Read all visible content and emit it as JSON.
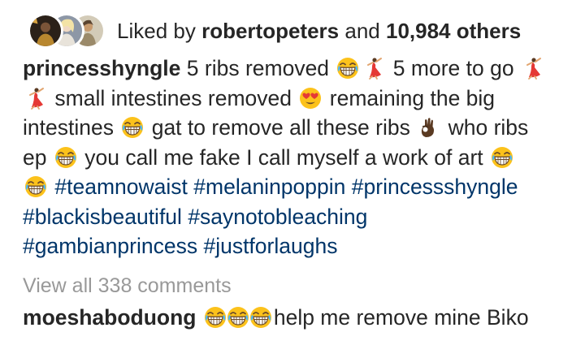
{
  "likes": {
    "prefix": "Liked by",
    "user": "robertopeters",
    "conjunction": "and",
    "count": "10,984 others"
  },
  "post": {
    "username": "princesshyngle",
    "caption_segments": [
      "5 ribs removed",
      "5 more to go",
      "small intestines removed",
      "remaining the big",
      "intestines",
      "gat to remove all these ribs",
      "who ribs",
      "ep",
      "you call me fake I call myself a work of art"
    ],
    "hashtags": [
      "#teamnowaist",
      "#melaninpoppin",
      "#princessshyngle",
      "#blackisbeautiful",
      "#saynotobleaching",
      "#gambianprincess",
      "#justforlaughs"
    ]
  },
  "comments": {
    "view_all": "View all 338 comments",
    "items": [
      {
        "username": "moeshaboduong",
        "text": "help me remove mine Biko"
      }
    ]
  },
  "icons": {
    "laughing": "face-with-tears-of-joy",
    "dancer": "dancer",
    "heart_eyes": "heart-eyes",
    "ok_hand": "ok-hand"
  },
  "colors": {
    "text": "#262626",
    "hashtag": "#003569",
    "muted": "#999999"
  }
}
